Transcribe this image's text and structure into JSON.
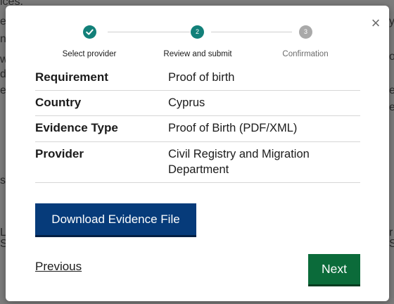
{
  "background": {
    "top_fragment": "ices.",
    "left_fragments": [
      "e",
      "n",
      "w",
      "d",
      "e",
      "s",
      "L",
      "S"
    ],
    "right_fragments": [
      "y",
      "o",
      "e",
      "e",
      "r",
      "S"
    ]
  },
  "modal": {
    "close_glyph": "×",
    "stepper": {
      "steps": [
        {
          "number": "1",
          "label": "Select provider",
          "state": "completed"
        },
        {
          "number": "2",
          "label": "Review and submit",
          "state": "current"
        },
        {
          "number": "3",
          "label": "Confirmation",
          "state": "upcoming"
        }
      ]
    },
    "details": [
      {
        "label": "Requirement",
        "value": "Proof of birth"
      },
      {
        "label": "Country",
        "value": "Cyprus"
      },
      {
        "label": "Evidence Type",
        "value": "Proof of Birth (PDF/XML)"
      },
      {
        "label": "Provider",
        "value": "Civil Registry and Migration Department"
      }
    ],
    "download_button": "Download Evidence File",
    "previous_link": "Previous",
    "next_button": "Next"
  },
  "colors": {
    "step_completed": "#128079",
    "step_current": "#128079",
    "step_upcoming": "#a9a9a9",
    "primary_button": "#063b7a",
    "next_button": "#0b6b3a"
  }
}
